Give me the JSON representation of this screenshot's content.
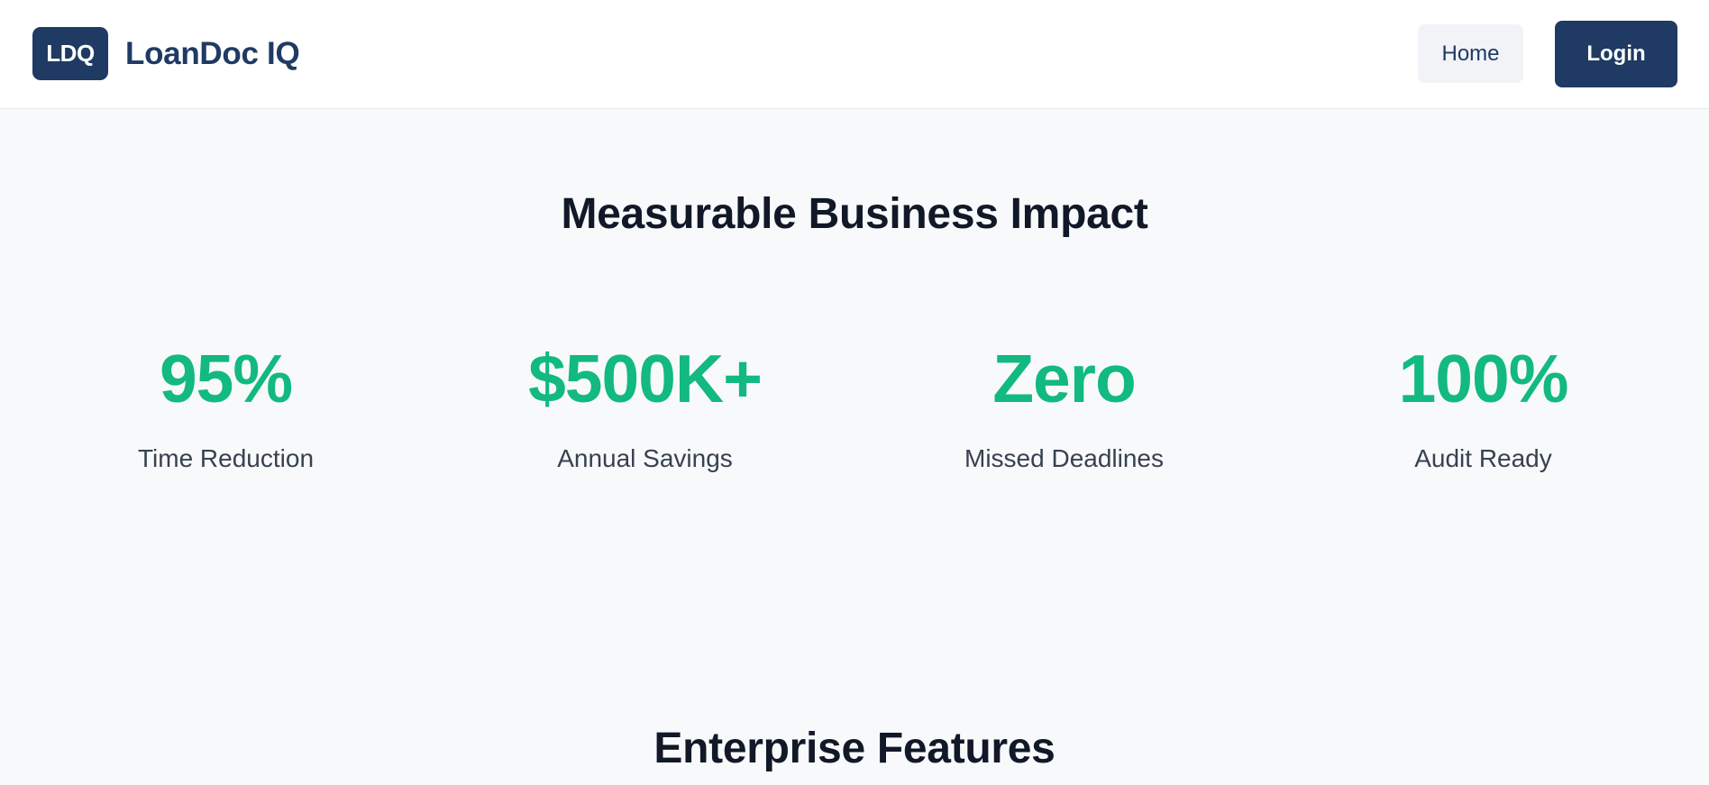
{
  "header": {
    "logo_text": "LDQ",
    "brand_name": "LoanDoc IQ",
    "nav": {
      "home_label": "Home",
      "login_label": "Login"
    }
  },
  "impact": {
    "title": "Measurable Business Impact",
    "stats": [
      {
        "value": "95%",
        "label": "Time Reduction"
      },
      {
        "value": "$500K+",
        "label": "Annual Savings"
      },
      {
        "value": "Zero",
        "label": "Missed Deadlines"
      },
      {
        "value": "100%",
        "label": "Audit Ready"
      }
    ]
  },
  "features": {
    "title": "Enterprise Features"
  },
  "colors": {
    "brand": "#1f3a63",
    "accent": "#12b981",
    "background": "#f8f9fb"
  }
}
